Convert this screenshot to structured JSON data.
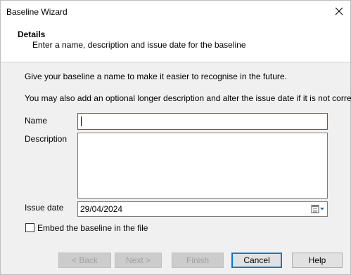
{
  "window": {
    "title": "Baseline Wizard",
    "close_icon": "close-icon"
  },
  "header": {
    "title": "Details",
    "subtitle": "Enter a name, description and issue date for the baseline"
  },
  "body": {
    "intro1": "Give your baseline a name to make it easier to recognise in the future.",
    "intro2": "You may also add an optional longer description and alter the issue date if it is not correct."
  },
  "form": {
    "name_label": "Name",
    "name_value": "",
    "description_label": "Description",
    "description_value": "",
    "issue_date_label": "Issue date",
    "issue_date_value": "29/04/2024",
    "embed_label": "Embed the baseline in the file",
    "embed_checked": false
  },
  "buttons": {
    "back": "< Back",
    "next": "Next >",
    "finish": "Finish",
    "cancel": "Cancel",
    "help": "Help"
  },
  "colors": {
    "accent": "#0078d7",
    "dialog_bg": "#f0f0f0"
  }
}
